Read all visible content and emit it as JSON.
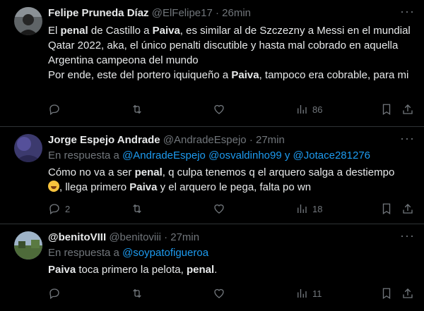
{
  "tweets": [
    {
      "name": "Felipe Pruneda Díaz",
      "handle": "@ElFelipe17",
      "sep": "·",
      "time": "26min",
      "text_parts": [
        {
          "t": "El ",
          "b": false
        },
        {
          "t": "penal",
          "b": true
        },
        {
          "t": " de Castillo a ",
          "b": false
        },
        {
          "t": "Paiva",
          "b": true
        },
        {
          "t": ", es similar al de Szczezny a Messi en el mundial Qatar 2022, aka, el único penalti discutible y hasta mal cobrado en aquella Argentina campeona del mundo",
          "b": false
        },
        {
          "t": "\nPor ende, este del portero iquiqueño a ",
          "b": false
        },
        {
          "t": "Paiva",
          "b": true
        },
        {
          "t": ", tampoco era cobrable, para mi",
          "b": false
        }
      ],
      "views": "86"
    },
    {
      "name": "Jorge Espejo Andrade",
      "handle": "@AndradeEspejo",
      "sep": "·",
      "time": "27min",
      "reply_prefix": "En respuesta a ",
      "reply_mentions": [
        "@AndradeEspejo",
        "@osvaldinho99",
        "@Jotace281276"
      ],
      "reply_joiner": "y",
      "text_parts": [
        {
          "t": "Cómo no va a ser ",
          "b": false
        },
        {
          "t": "penal",
          "b": true
        },
        {
          "t": ",  q culpa tenemos q el arquero salga a destiempo",
          "b": false
        },
        {
          "t": "\n",
          "b": false
        },
        {
          "t": "{emoji}",
          "b": false
        },
        {
          "t": ", llega primero ",
          "b": false
        },
        {
          "t": "Paiva",
          "b": true
        },
        {
          "t": " y el arquero le pega, falta po wn",
          "b": false
        }
      ],
      "replies": "2",
      "views": "18"
    },
    {
      "name": "@benitoVIII",
      "handle": "@benitoviii",
      "sep": "·",
      "time": "27min",
      "reply_prefix": "En respuesta a ",
      "reply_mentions": [
        "@soypatofigueroa"
      ],
      "text_parts": [
        {
          "t": "Paiva",
          "b": true
        },
        {
          "t": " toca primero la pelota, ",
          "b": false
        },
        {
          "t": "penal",
          "b": true
        },
        {
          "t": ".",
          "b": false
        }
      ],
      "views": "11"
    }
  ],
  "icons": {
    "reply": "reply-icon",
    "retweet": "retweet-icon",
    "like": "heart-icon",
    "views": "views-icon",
    "bookmark": "bookmark-icon",
    "share": "share-icon",
    "more": "more-icon",
    "emoji": "rolling-laughing-emoji"
  },
  "colors": {
    "background": "#000000",
    "text": "#e7e9ea",
    "muted": "#71767b",
    "link": "#1d9bf0",
    "border": "#2f3336"
  }
}
